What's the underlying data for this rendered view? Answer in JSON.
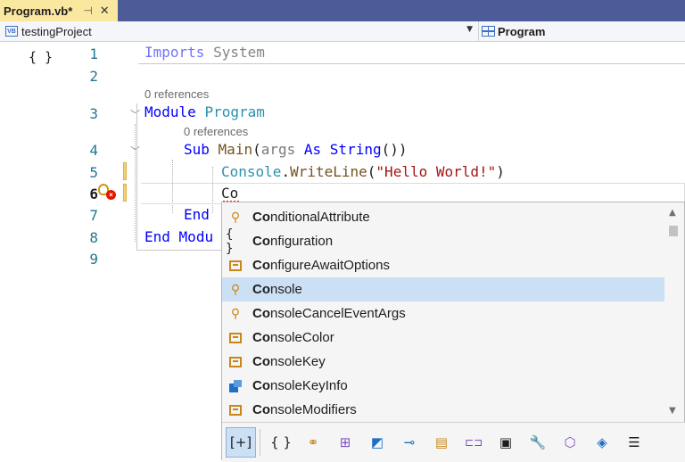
{
  "tab": {
    "title": "Program.vb*",
    "pin_glyph": "⊣",
    "close_glyph": "✕"
  },
  "navbar": {
    "project": "testingProject",
    "type": "Program",
    "project_icon": "VB"
  },
  "editor": {
    "glyph_button": "{ }",
    "line_numbers": [
      "1",
      "2",
      "3",
      "4",
      "5",
      "6",
      "7",
      "8",
      "9"
    ],
    "references": [
      "0 references",
      "0 references"
    ],
    "lines": {
      "l1_kw": "Imports",
      "l1_ns": "System",
      "l3_kw": "Module",
      "l3_name": "Program",
      "l4_kw": "Sub",
      "l4_name": "Main",
      "l4_open": "(",
      "l4_param": "args",
      "l4_as": "As",
      "l4_type": "String",
      "l4_close": "())",
      "l5_class": "Console",
      "l5_dot": ".",
      "l5_method": "WriteLine",
      "l5_open": "(",
      "l5_str": "\"Hello World!\"",
      "l5_close": ")",
      "l6_typed": "Co",
      "l7_kw": "End",
      "l8_kw": "End",
      "l8_text": "Modu"
    }
  },
  "completion": {
    "items": [
      {
        "match": "Co",
        "rest": "nditionalAttribute",
        "icon": "attribute-icon"
      },
      {
        "match": "Co",
        "rest": "nfiguration",
        "icon": "namespace-icon"
      },
      {
        "match": "Co",
        "rest": "nfigureAwaitOptions",
        "icon": "enum-icon"
      },
      {
        "match": "Co",
        "rest": "nsole",
        "icon": "class-icon",
        "selected": true
      },
      {
        "match": "Co",
        "rest": "nsoleCancelEventArgs",
        "icon": "class-icon"
      },
      {
        "match": "Co",
        "rest": "nsoleColor",
        "icon": "enum-icon"
      },
      {
        "match": "Co",
        "rest": "nsoleKey",
        "icon": "enum-icon"
      },
      {
        "match": "Co",
        "rest": "nsoleKeyInfo",
        "icon": "struct-icon"
      },
      {
        "match": "Co",
        "rest": "nsoleModifiers",
        "icon": "enum-icon"
      }
    ],
    "filters": [
      {
        "name": "snippets-filter-icon",
        "glyph": "[+]"
      },
      {
        "name": "namespaces-filter-icon",
        "glyph": "{ }"
      },
      {
        "name": "classes-filter-icon",
        "glyph": "⚭"
      },
      {
        "name": "modules-filter-icon",
        "glyph": "⊞"
      },
      {
        "name": "structures-filter-icon",
        "glyph": "◩"
      },
      {
        "name": "interfaces-filter-icon",
        "glyph": "⊸"
      },
      {
        "name": "enums-filter-icon",
        "glyph": "▤"
      },
      {
        "name": "delegates-filter-icon",
        "glyph": "⊏⊐"
      },
      {
        "name": "constants-filter-icon",
        "glyph": "▣"
      },
      {
        "name": "properties-filter-icon",
        "glyph": "🔧"
      },
      {
        "name": "methods-filter-icon",
        "glyph": "⬡"
      },
      {
        "name": "fields-filter-icon",
        "glyph": "◈"
      },
      {
        "name": "keywords-filter-icon",
        "glyph": "☰"
      }
    ]
  },
  "colors": {
    "tab_active": "#fbe8a0",
    "tabstrip": "#4d5c99",
    "keyword": "#0000ff",
    "type": "#2b91af",
    "string": "#a31515",
    "selected_item": "#cce0f5"
  }
}
